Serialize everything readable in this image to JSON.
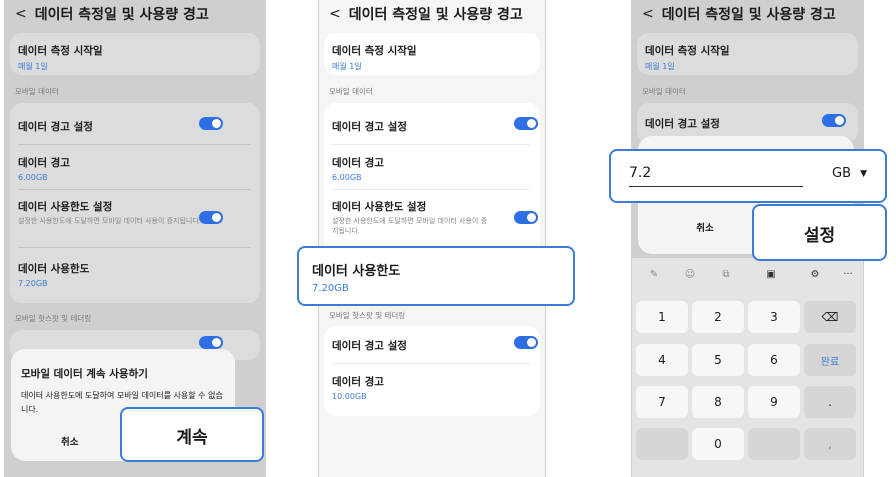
{
  "header_title": "데이터 측정일 및 사용량 경고",
  "back_glyph": "<",
  "start_title": "데이터 측정 시작일",
  "start_value": "매월 1일",
  "mobile_section": "모바일 데이터",
  "warn_setting": "데이터 경고 설정",
  "warn_title": "데이터 경고",
  "warn_value": "6.00GB",
  "limit_setting_title": "데이터 사용한도 설정",
  "limit_setting_desc": "설정한 사용한도에 도달하면 모바일 데이터 사용이 중지됩니다.",
  "limit_title": "데이터 사용한도",
  "limit_value_1": "7.20GB",
  "limit_value_2": "7.20GB",
  "hotspot_section": "모바일 핫스팟 및 테더링",
  "hotspot_warn_setting": "데이터 경고 설정",
  "hotspot_warn_title": "데이터 경고",
  "hotspot_warn_value": "10.00GB",
  "dialog1": {
    "title": "모바일 데이터 계속 사용하기",
    "body": "데이터 사용한도에 도달하여 모바일 데이터를 사용할 수 없습니다.",
    "cancel": "취소",
    "continue": "계속"
  },
  "dialog3": {
    "input_value": "7.2",
    "unit": "GB",
    "dropdown_glyph": "▼",
    "cancel": "취소",
    "confirm": "설정"
  },
  "keypad": {
    "keys": [
      "1",
      "2",
      "3",
      "⌫",
      "4",
      "5",
      "6",
      "완료",
      "7",
      "8",
      "9",
      ".",
      "",
      "0",
      "",
      ","
    ],
    "toolbar": [
      "✎",
      "☺",
      "⧉",
      "▣",
      "⚙",
      "···"
    ]
  },
  "colors": {
    "accent": "#3d7bd9",
    "toggle": "#2f6fe6"
  }
}
